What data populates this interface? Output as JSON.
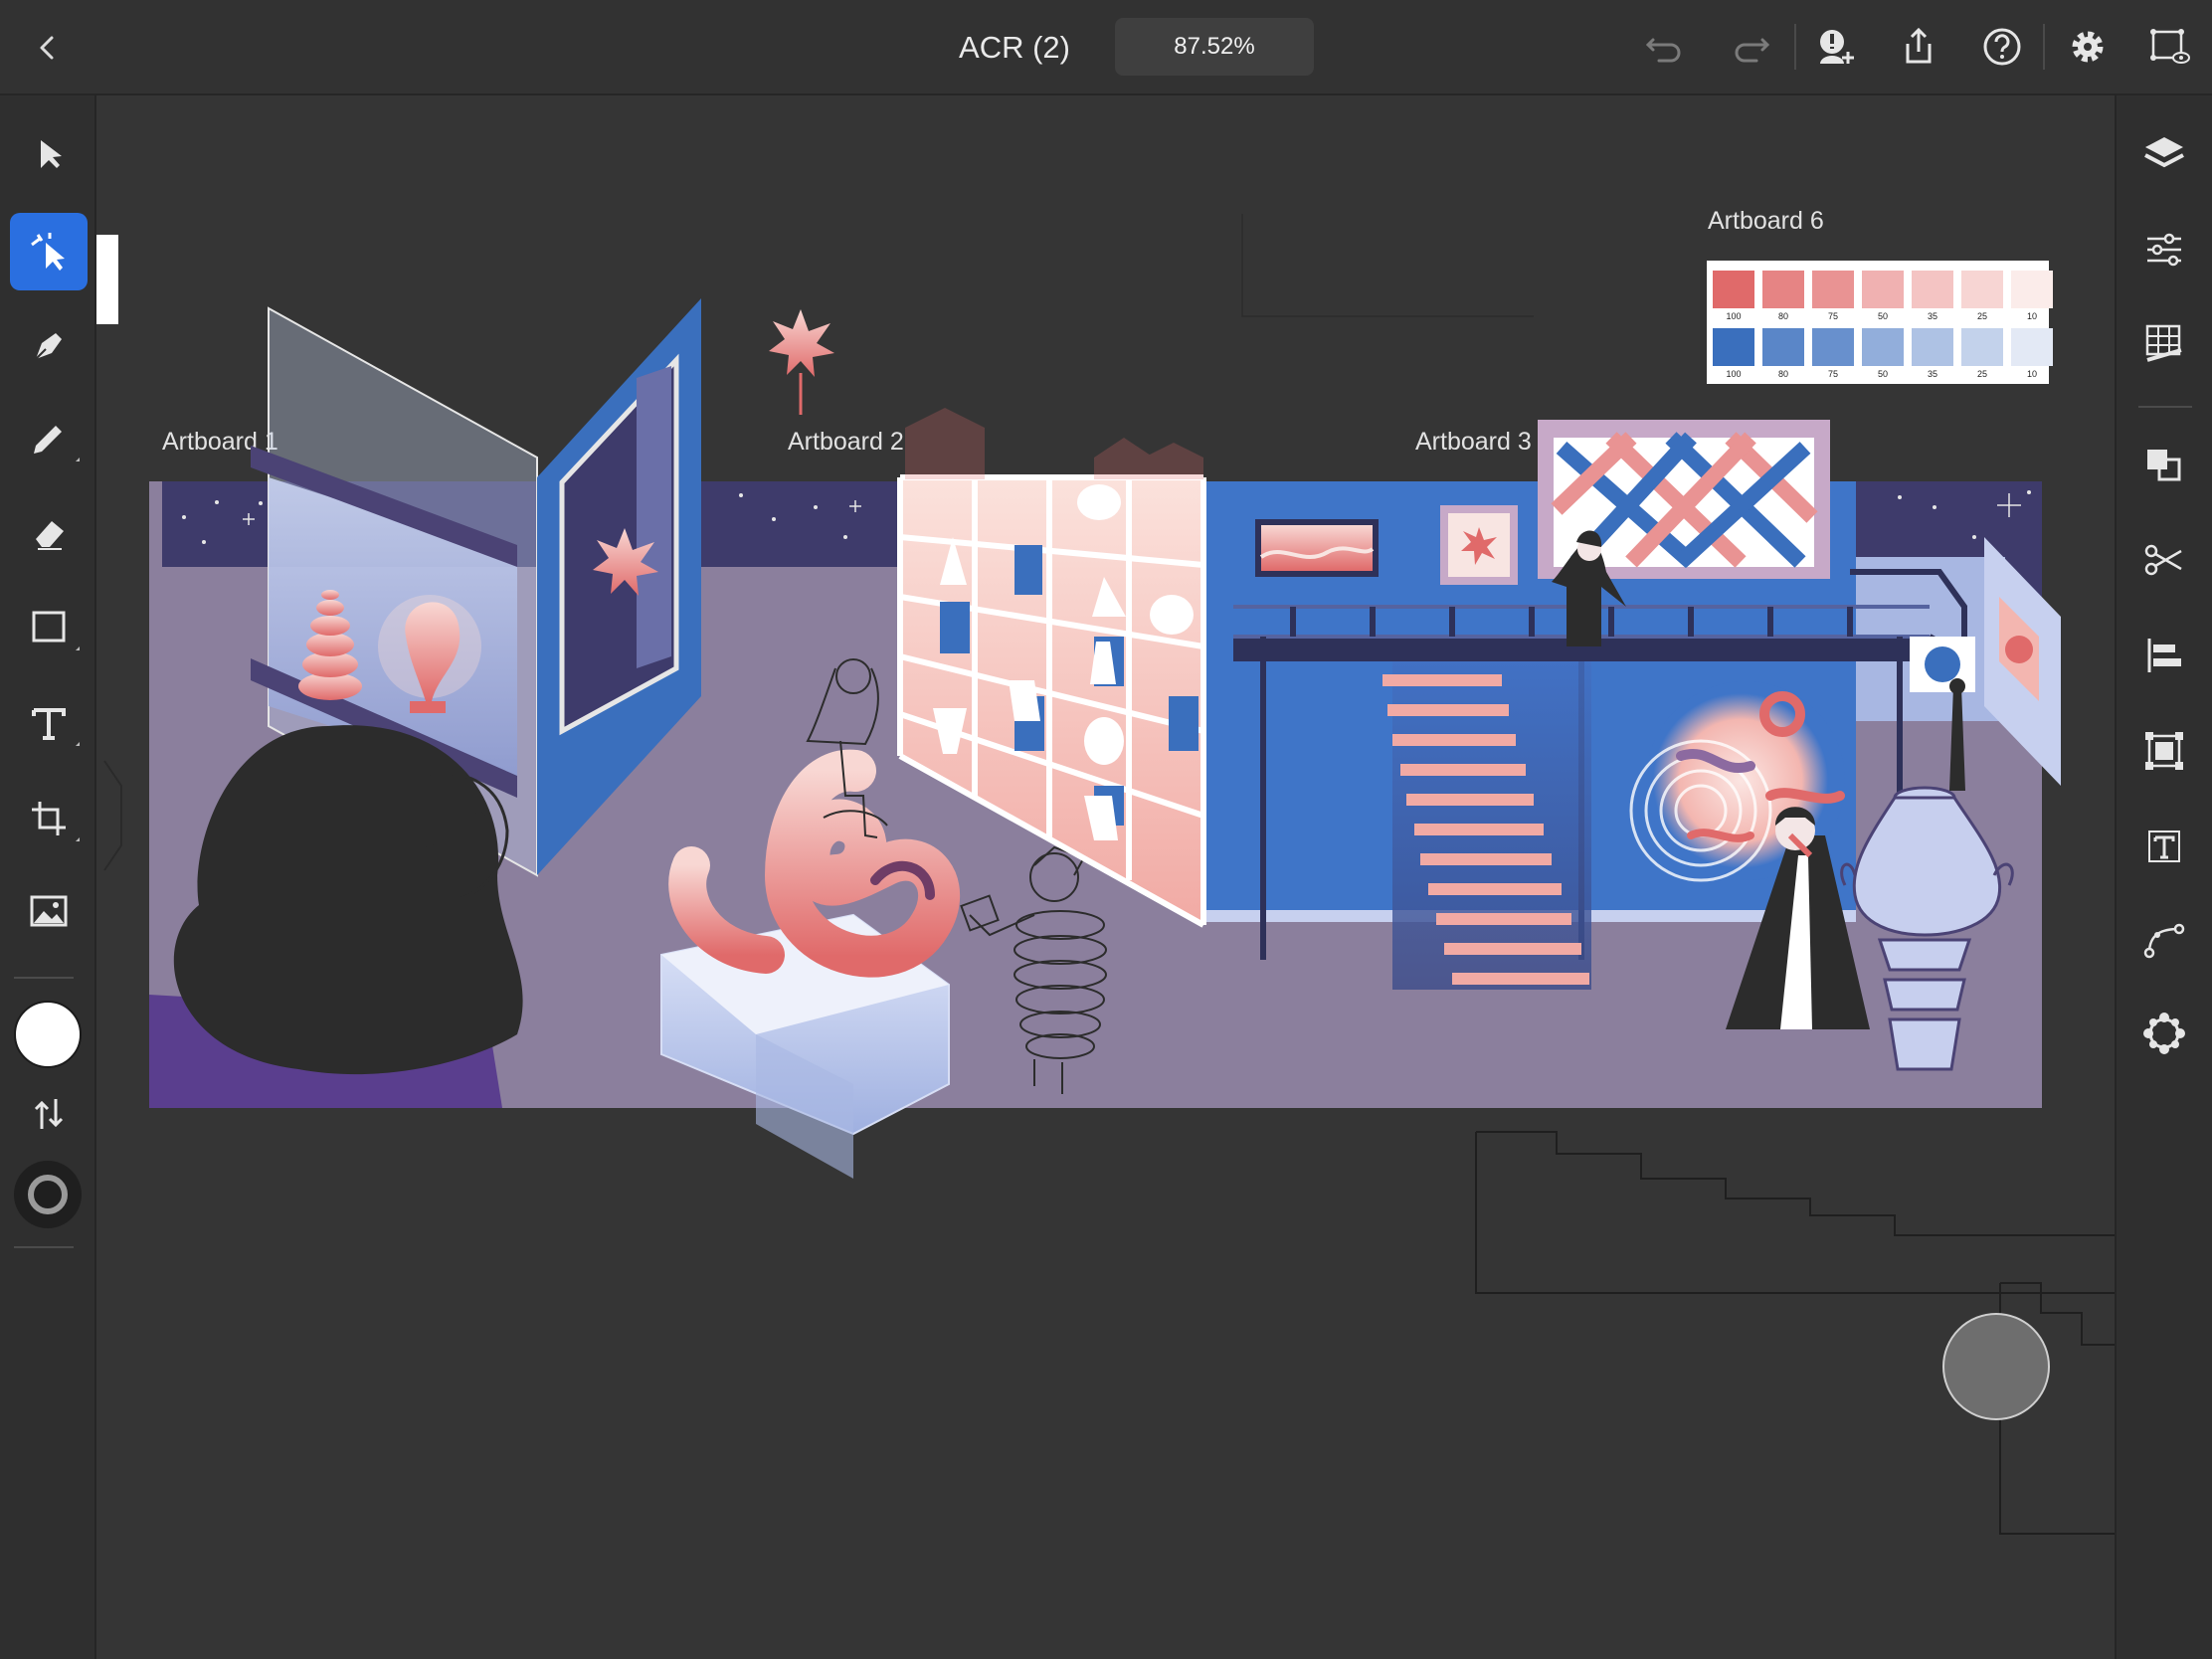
{
  "header": {
    "title": "ACR (2)",
    "zoom": "87.52%",
    "icons": [
      "back-icon",
      "undo-icon",
      "redo-icon",
      "invite-icon",
      "share-icon",
      "help-icon",
      "settings-icon",
      "preview-icon"
    ]
  },
  "left_tools": [
    "select-tool",
    "direct-select-tool",
    "pen-tool",
    "pencil-tool",
    "eraser-tool",
    "rectangle-tool",
    "type-tool",
    "artboard-tool",
    "image-tool",
    "fill-color",
    "swap-fill-stroke",
    "stroke-color"
  ],
  "right_panel": [
    "layers-icon",
    "properties-icon",
    "grid-icon",
    "combine-icon",
    "cut-icon",
    "align-icon",
    "transform-icon",
    "text-icon",
    "path-icon",
    "repeat-icon"
  ],
  "artboards": {
    "a1": "Artboard 1",
    "a2": "Artboard 2",
    "a3": "Artboard 3",
    "a6": "Artboard 6"
  },
  "swatches": {
    "red": [
      {
        "label": "100",
        "color": "#e06a6a"
      },
      {
        "label": "80",
        "color": "#e68484"
      },
      {
        "label": "75",
        "color": "#e99393"
      },
      {
        "label": "50",
        "color": "#f0b1b1"
      },
      {
        "label": "35",
        "color": "#f4c4c3"
      },
      {
        "label": "25",
        "color": "#f7d5d3"
      },
      {
        "label": "10",
        "color": "#fbecea"
      }
    ],
    "blue": [
      {
        "label": "100",
        "color": "#3a6fbd"
      },
      {
        "label": "80",
        "color": "#5a86c8"
      },
      {
        "label": "75",
        "color": "#6890cd"
      },
      {
        "label": "50",
        "color": "#92aedb"
      },
      {
        "label": "35",
        "color": "#aec2e4"
      },
      {
        "label": "25",
        "color": "#c3d2eb"
      },
      {
        "label": "10",
        "color": "#e3e9f5"
      }
    ]
  },
  "colors": {
    "accent": "#2a6fe0",
    "canvas": "#353535",
    "bar": "#323232"
  }
}
